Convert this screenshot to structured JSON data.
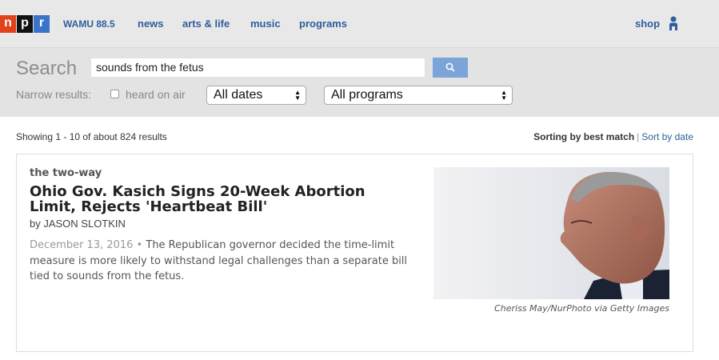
{
  "header": {
    "logo_letters": [
      "n",
      "p",
      "r"
    ],
    "station": "WAMU 88.5",
    "nav": [
      "news",
      "arts & life",
      "music",
      "programs"
    ],
    "shop": "shop",
    "user_icon": "user-icon"
  },
  "search": {
    "label": "Search",
    "query": "sounds from the fetus",
    "button_icon": "search-icon",
    "narrow_label": "Narrow results:",
    "heard_on_air_label": "heard on air",
    "heard_on_air_checked": false,
    "dates_selected": "All dates",
    "programs_selected": "All programs"
  },
  "results": {
    "showing": "Showing 1 - 10 of about 824 results",
    "sort_current": "Sorting by best match",
    "sort_separator": "|",
    "sort_alt": "Sort by date"
  },
  "result_item": {
    "slug": "the two-way",
    "headline": "Ohio Gov. Kasich Signs 20-Week Abortion Limit, Rejects 'Heartbeat Bill'",
    "byline": "by JASON SLOTKIN",
    "date": "December 13, 2016",
    "date_separator": " • ",
    "teaser": "The Republican governor decided the time-limit measure is more likely to withstand legal challenges than a separate bill tied to sounds from the fetus.",
    "photo_credit": "Cheriss May/NurPhoto via Getty Images"
  },
  "colors": {
    "link": "#2e5e9d",
    "topbar": "#e8e8e8",
    "search_button": "#7ba4d8"
  }
}
